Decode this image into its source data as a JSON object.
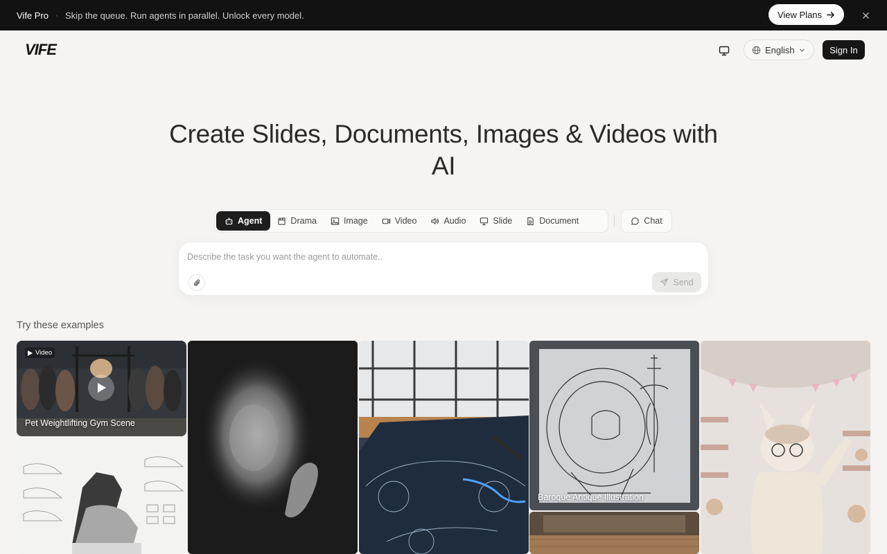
{
  "promo": {
    "brand": "Vife Pro",
    "separator": "·",
    "message": "Skip the queue. Run agents in parallel. Unlock every model.",
    "cta_label": "View Plans"
  },
  "header": {
    "logo_text": "VIFE",
    "language_label": "English",
    "signin_label": "Sign In"
  },
  "hero": {
    "title": "Create Slides, Documents, Images & Videos with AI"
  },
  "tabs": [
    {
      "label": "Agent",
      "icon": "robot-icon",
      "active": true
    },
    {
      "label": "Drama",
      "icon": "clapperboard-icon"
    },
    {
      "label": "Image",
      "icon": "image-icon"
    },
    {
      "label": "Video",
      "icon": "video-camera-icon"
    },
    {
      "label": "Audio",
      "icon": "speaker-icon"
    },
    {
      "label": "Slide",
      "icon": "presentation-icon"
    },
    {
      "label": "Document",
      "icon": "document-icon"
    }
  ],
  "chat_tab": {
    "label": "Chat",
    "icon": "chat-bubble-icon"
  },
  "prompt": {
    "placeholder": "Describe the task you want the agent to automate..",
    "send_label": "Send"
  },
  "examples": {
    "title": "Try these examples",
    "cards": [
      {
        "caption": "Pet Weightlifting Gym Scene",
        "badge": "Video"
      },
      {
        "caption": ""
      },
      {
        "caption": ""
      },
      {
        "caption": ""
      },
      {
        "caption": "Baroque Antique Illustration"
      },
      {
        "caption": ""
      },
      {
        "caption": ""
      }
    ]
  },
  "colors": {
    "background": "#f5f4f2",
    "banner": "#121212",
    "primary_button": "#161616",
    "active_tab": "#1d1d1d"
  }
}
